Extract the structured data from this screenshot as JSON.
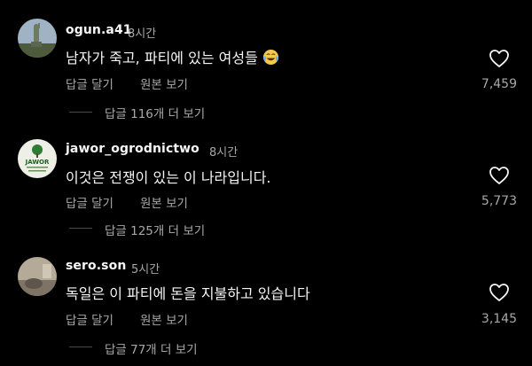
{
  "comments": [
    {
      "username": "ogun.a41",
      "time": "8시간",
      "text": "남자가 죽고, 파티에 있는 여성들",
      "emoji_icon": "face-with-tears-of-joy-icon",
      "reply_label": "답글 달기",
      "original_label": "원본 보기",
      "likes": "7,459",
      "view_replies": "답글 116개 더 보기"
    },
    {
      "username": "jawor_ogrodnictwo",
      "time": "8시간",
      "text": "이것은 전쟁이 있는 이 나라입니다.",
      "avatar_text": "JAWOR",
      "reply_label": "답글 달기",
      "original_label": "원본 보기",
      "likes": "5,773",
      "view_replies": "답글 125개 더 보기"
    },
    {
      "username": "sero.son",
      "time": "5시간",
      "text": "독일은 이 파티에 돈을 지불하고 있습니다",
      "reply_label": "답글 달기",
      "original_label": "원본 보기",
      "likes": "3,145",
      "view_replies": "답글 77개 더 보기"
    }
  ],
  "colors": {
    "background": "#000000",
    "primary_text": "#f5f5f5",
    "secondary_text": "#a8a8a8"
  }
}
